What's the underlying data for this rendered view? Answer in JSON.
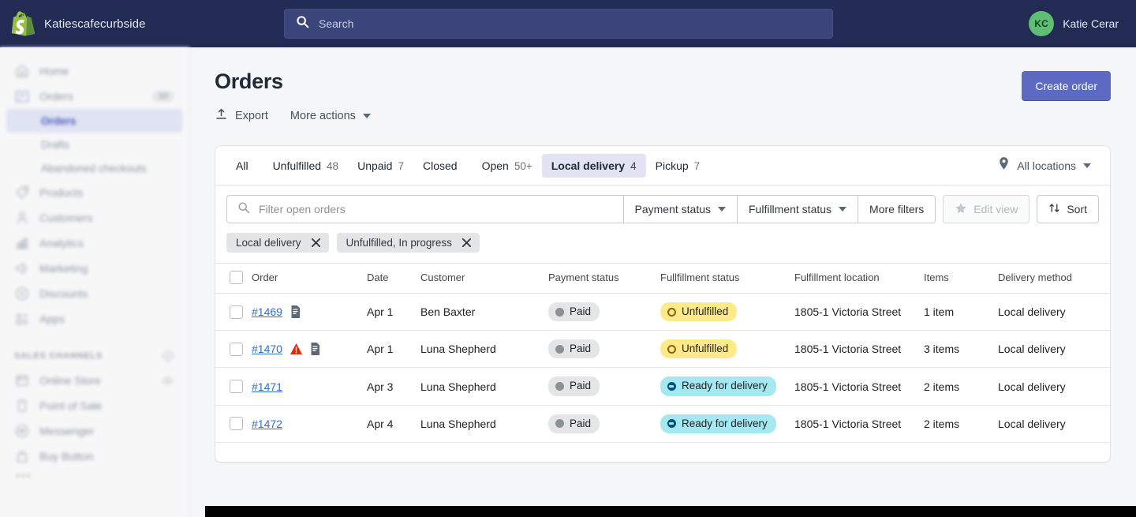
{
  "topbar": {
    "logo_icon": "shopify-bag-icon",
    "store_name": "Katiescafecurbside",
    "search": {
      "icon": "search-icon",
      "placeholder": "Search",
      "value": ""
    },
    "account": {
      "initials": "KC",
      "name": "Katie Cerar",
      "avatar_color": "#5fbd74"
    }
  },
  "sidebar": {
    "items": [
      {
        "label": "Home",
        "icon": "home-icon",
        "badge": ""
      },
      {
        "label": "Orders",
        "icon": "orders-icon",
        "badge": "10"
      },
      {
        "label": "Products",
        "icon": "products-tag-icon",
        "badge": ""
      },
      {
        "label": "Customers",
        "icon": "customers-icon",
        "badge": ""
      },
      {
        "label": "Analytics",
        "icon": "analytics-bars-icon",
        "badge": ""
      },
      {
        "label": "Marketing",
        "icon": "marketing-megaphone-icon",
        "badge": ""
      },
      {
        "label": "Discounts",
        "icon": "discounts-icon",
        "badge": ""
      },
      {
        "label": "Apps",
        "icon": "apps-grid-icon",
        "badge": ""
      }
    ],
    "sub_items": [
      {
        "label": "Orders",
        "active": true
      },
      {
        "label": "Drafts",
        "active": false
      },
      {
        "label": "Abandoned checkouts",
        "active": false
      }
    ],
    "section": {
      "title": "SALES CHANNELS",
      "action_icon": "plus-circle-icon",
      "channels": [
        {
          "label": "Online Store",
          "icon": "online-store-icon",
          "action_icon": "eye-icon"
        },
        {
          "label": "Point of Sale",
          "icon": "point-of-sale-icon",
          "action_icon": ""
        },
        {
          "label": "Messenger",
          "icon": "messenger-icon",
          "action_icon": ""
        },
        {
          "label": "Buy Button",
          "icon": "buy-button-icon",
          "action_icon": ""
        }
      ],
      "more": "•••"
    }
  },
  "page": {
    "title": "Orders",
    "actions": [
      {
        "label": "Export",
        "icon": "upload-arrow-icon"
      },
      {
        "label": "More actions",
        "icon": "chevron-down-icon"
      }
    ],
    "primary_button": "Create order"
  },
  "tabs": [
    {
      "label": "All",
      "count": "",
      "active": false
    },
    {
      "label": "Unfulfilled",
      "count": "48",
      "active": false
    },
    {
      "label": "Unpaid",
      "count": "7",
      "active": false
    },
    {
      "label": "Closed",
      "count": "",
      "active": false
    },
    {
      "label": "Open",
      "count": "50+",
      "active": false
    },
    {
      "label": "Local delivery",
      "count": "4",
      "active": true
    },
    {
      "label": "Pickup",
      "count": "7",
      "active": false
    }
  ],
  "locations_selector": {
    "icon": "location-pin-icon",
    "label": "All locations",
    "caret": "chevron-down-icon"
  },
  "filter_bar": {
    "search": {
      "icon": "search-icon",
      "placeholder": "Filter open orders",
      "value": ""
    },
    "buttons": [
      {
        "label": "Payment status",
        "caret": true
      },
      {
        "label": "Fulfillment status",
        "caret": true
      },
      {
        "label": "More filters",
        "caret": false
      }
    ],
    "edit_view": {
      "label": "Edit view",
      "icon": "star-icon",
      "disabled": true
    },
    "sort": {
      "label": "Sort",
      "icon": "sort-arrows-icon"
    }
  },
  "applied_filters": [
    {
      "label": "Local delivery",
      "remove_icon": "close-icon"
    },
    {
      "label": "Unfulfilled, In progress",
      "remove_icon": "close-icon"
    }
  ],
  "table": {
    "columns": [
      "Order",
      "Date",
      "Customer",
      "Payment status",
      "Fullfillment status",
      "Fulfillment location",
      "Items",
      "Delivery method"
    ],
    "select_all": {
      "checked": false
    },
    "rows": [
      {
        "order": "#1469",
        "icons": [
          "note-icon"
        ],
        "date": "Apr 1",
        "customer": "Ben Baxter",
        "payment_status": "Paid",
        "payment_tone": "grey",
        "fulfillment_status": "Unfulfilled",
        "fulfillment_tone": "warning",
        "location": "1805-1 Victoria Street",
        "items": "1 item",
        "delivery_method": "Local delivery"
      },
      {
        "order": "#1470",
        "icons": [
          "alert-triangle-icon",
          "note-icon"
        ],
        "date": "Apr 1",
        "customer": "Luna Shepherd",
        "payment_status": "Paid",
        "payment_tone": "grey",
        "fulfillment_status": "Unfulfilled",
        "fulfillment_tone": "warning",
        "location": "1805-1 Victoria Street",
        "items": "3 items",
        "delivery_method": "Local delivery"
      },
      {
        "order": "#1471",
        "icons": [],
        "date": "Apr 3",
        "customer": "Luna Shepherd",
        "payment_status": "Paid",
        "payment_tone": "grey",
        "fulfillment_status": "Ready for delivery",
        "fulfillment_tone": "info",
        "location": "1805-1 Victoria Street",
        "items": "2 items",
        "delivery_method": "Local delivery"
      },
      {
        "order": "#1472",
        "icons": [],
        "date": "Apr 4",
        "customer": "Luna Shepherd",
        "payment_status": "Paid",
        "payment_tone": "grey",
        "fulfillment_status": "Ready for delivery",
        "fulfillment_tone": "info",
        "location": "1805-1 Victoria Street",
        "items": "2 items",
        "delivery_method": "Local delivery"
      }
    ]
  },
  "colors": {
    "topbar_bg": "#212b54",
    "primary": "#5c6ac4",
    "link": "#2c6ecb",
    "badge_warning": "#ffea8a",
    "badge_info": "#a4e8f2",
    "badge_neutral": "#e4e5e7",
    "avatar_green": "#5fbd74",
    "page_bg": "#f4f6f8"
  }
}
